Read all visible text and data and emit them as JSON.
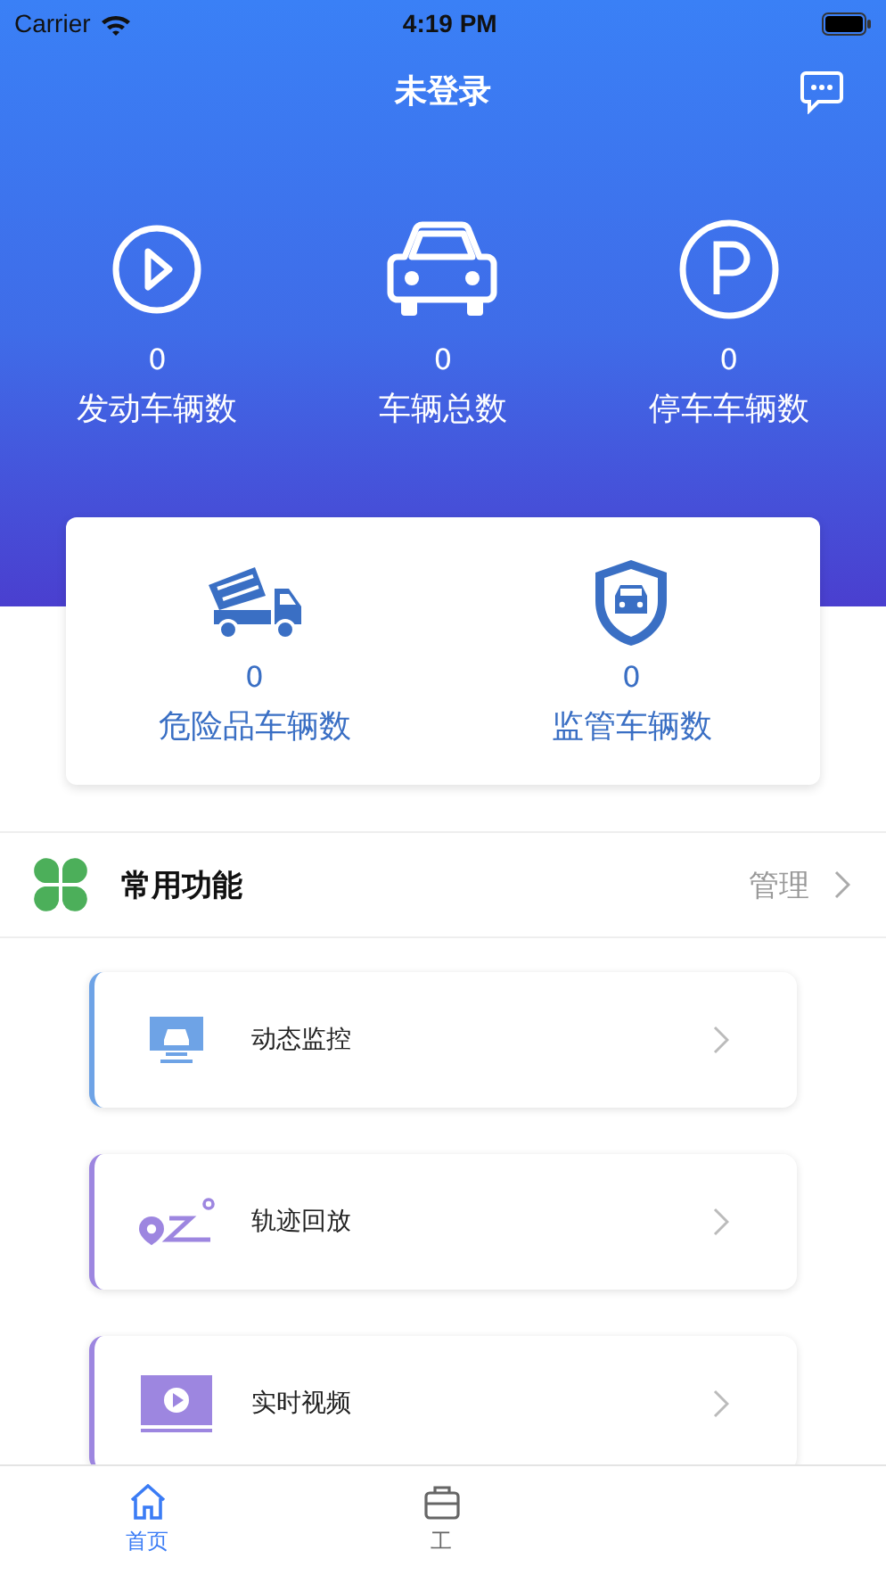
{
  "status_bar": {
    "carrier": "Carrier",
    "time": "4:19 PM"
  },
  "header": {
    "title": "未登录"
  },
  "stats": [
    {
      "kind": "engine",
      "value": "0",
      "label": "发动车辆数"
    },
    {
      "kind": "car",
      "value": "0",
      "label": "车辆总数"
    },
    {
      "kind": "parking",
      "value": "0",
      "label": "停车车辆数"
    }
  ],
  "special_stats": [
    {
      "kind": "truck",
      "value": "0",
      "label": "危险品车辆数"
    },
    {
      "kind": "shield",
      "value": "0",
      "label": "监管车辆数"
    }
  ],
  "section": {
    "title": "常用功能",
    "action": "管理"
  },
  "functions": [
    {
      "kind": "monitor",
      "label": "动态监控",
      "color": "#6ea3e6"
    },
    {
      "kind": "track",
      "label": "轨迹回放",
      "color": "#9d86e0"
    },
    {
      "kind": "video",
      "label": "实时视频",
      "color": "#9d86e0"
    }
  ],
  "tab_bar": [
    {
      "kind": "home",
      "label": "首页",
      "selected": true
    },
    {
      "kind": "work",
      "label": "工",
      "selected": false
    }
  ]
}
